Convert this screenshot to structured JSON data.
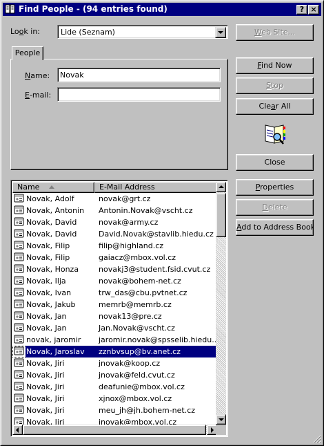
{
  "window": {
    "title": "Find People - (94 entries found)",
    "help_label": "?",
    "close_label": "×"
  },
  "look_in": {
    "label_pre": "Lo",
    "label_accel": "o",
    "label_post": "k in:",
    "value": "Lide (Seznam)"
  },
  "tab": {
    "label": "People"
  },
  "name_field": {
    "label_accel": "N",
    "label_post": "ame:",
    "value": "Novak"
  },
  "email_field": {
    "label_accel": "E",
    "label_post": "-mail:",
    "value": ""
  },
  "buttons": {
    "web_site": {
      "accel": "W",
      "rest": "eb Site..."
    },
    "find_now": {
      "accel": "F",
      "rest": "ind Now"
    },
    "stop": {
      "accel": "S",
      "rest": "top"
    },
    "clear_all": {
      "pre": "Cle",
      "accel": "a",
      "rest": "r All"
    },
    "close": "Close",
    "properties": {
      "accel": "P",
      "rest": "roperties"
    },
    "delete": {
      "accel": "D",
      "rest": "elete"
    },
    "add_to_address_book": {
      "accel": "A",
      "rest": "dd to Address Book"
    }
  },
  "results": {
    "columns": [
      "Name",
      "E-Mail Address"
    ],
    "sort_column": "Name",
    "selected_index": 13,
    "rows": [
      {
        "name": "Novak, Adolf",
        "email": "novak@grt.cz"
      },
      {
        "name": "Novak, Antonin",
        "email": "Antonin.Novak@vscht.cz"
      },
      {
        "name": "Novak, David",
        "email": "novak@army.cz"
      },
      {
        "name": "Novak, David",
        "email": "David.Novak@stavlib.hiedu.cz"
      },
      {
        "name": "Novak, Filip",
        "email": "filip@highland.cz"
      },
      {
        "name": "Novak, Filip",
        "email": "gaiacz@mbox.vol.cz"
      },
      {
        "name": "Novak, Honza",
        "email": "novakj3@student.fsid.cvut.cz"
      },
      {
        "name": "Novak, Ilja",
        "email": "novak@bohem-net.cz"
      },
      {
        "name": "Novak, Ivan",
        "email": "trw_das@cbu.pvtnet.cz"
      },
      {
        "name": "Novak, Jakub",
        "email": "memrb@memrb.cz"
      },
      {
        "name": "Novak, Jan",
        "email": "novak13@pre.cz"
      },
      {
        "name": "Novak, Jan",
        "email": "Jan.Novak@vscht.cz"
      },
      {
        "name": "novak, jaromir",
        "email": "jaromir.novak@spsselib.hiedu..."
      },
      {
        "name": "Novak, Jaroslav",
        "email": "zznbvsup@bv.anet.cz"
      },
      {
        "name": "Novak, Jiri",
        "email": "jnovak@koop.cz"
      },
      {
        "name": "Novak, Jiri",
        "email": "jnovak@feld.cvut.cz"
      },
      {
        "name": "Novak, Jiri",
        "email": "deafunie@mbox.vol.cz"
      },
      {
        "name": "Novak, Jiri",
        "email": "xjnox@mbox.vol.cz"
      },
      {
        "name": "Novak, Jiri",
        "email": "meu_jh@jh.bohem-net.cz"
      },
      {
        "name": "Novak, Jiri",
        "email": "jnovak@mbox.vol.cz"
      }
    ]
  },
  "colors": {
    "titlebar": "#000080",
    "face": "#c0c0c0",
    "selection": "#000080"
  }
}
